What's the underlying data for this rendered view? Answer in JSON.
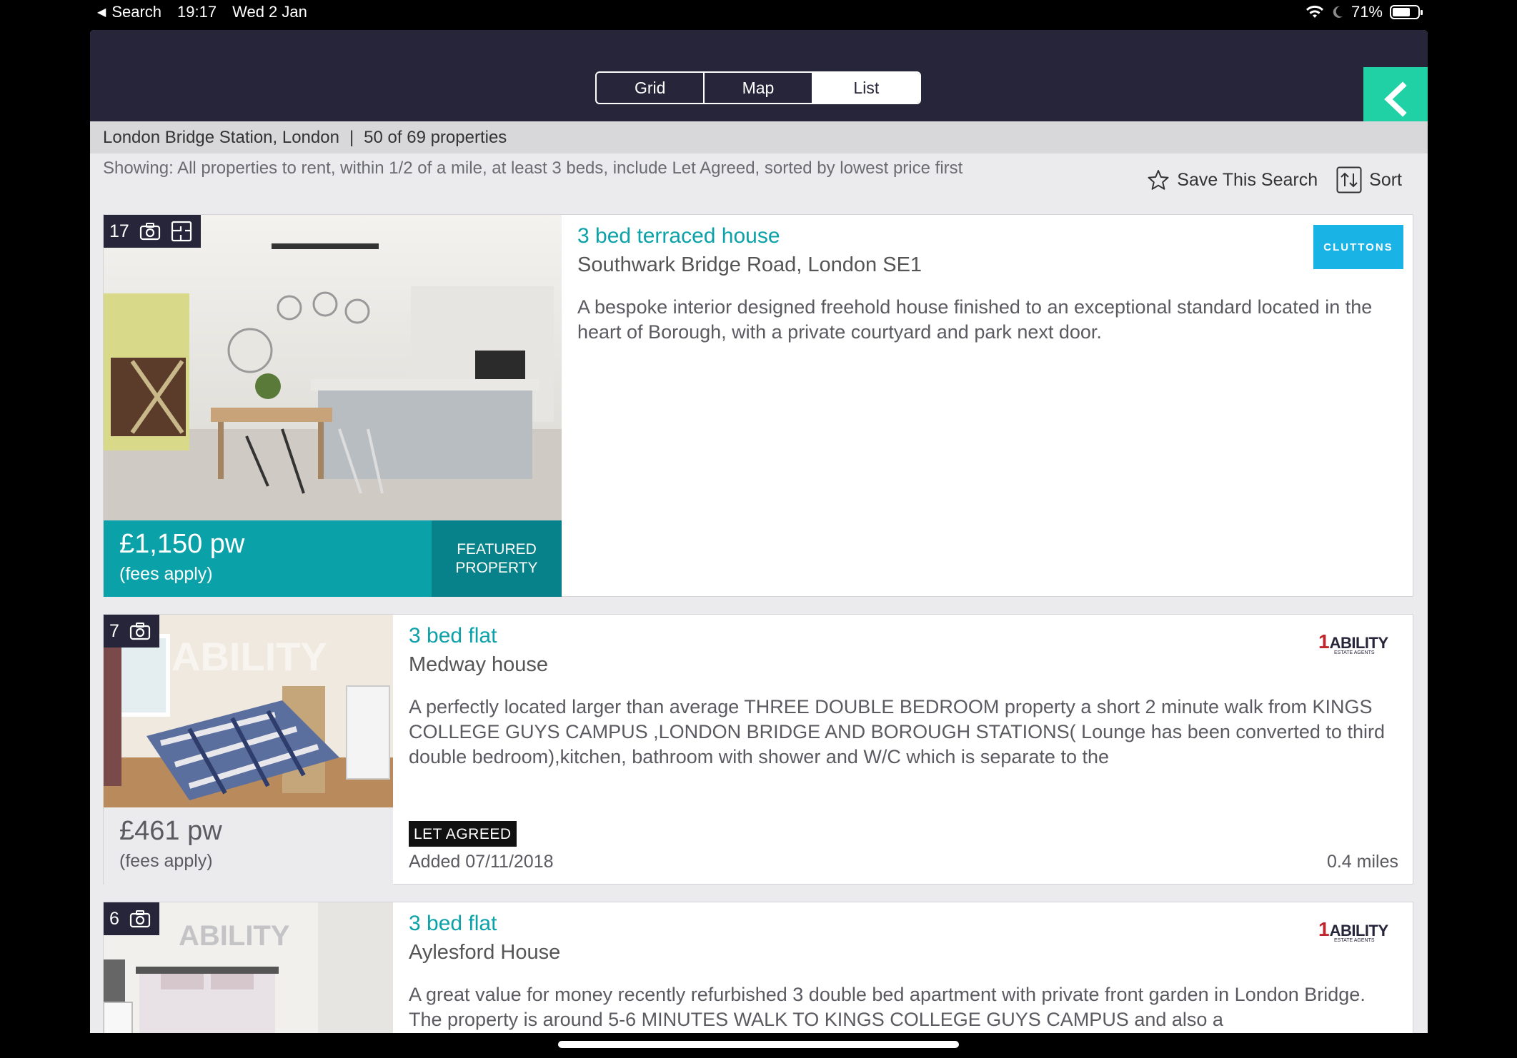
{
  "status": {
    "back_label": "Search",
    "time": "19:17",
    "date": "Wed 2 Jan",
    "battery": "71%",
    "battery_level": 0.71
  },
  "view_tabs": [
    {
      "label": "Grid",
      "active": false
    },
    {
      "label": "Map",
      "active": false
    },
    {
      "label": "List",
      "active": true
    }
  ],
  "colors": {
    "header": "#26253a",
    "accent_teal": "#0aa2a8",
    "back_button": "#1fd1a5",
    "cluttons": "#1ab3e6"
  },
  "location": {
    "place": "London Bridge Station, London",
    "separator": "|",
    "count": "50 of 69 properties"
  },
  "filter": {
    "text": "Showing: All properties to rent, within 1/2 of a mile, at least 3 beds, include Let Agreed, sorted by lowest price first",
    "save_label": "Save This Search",
    "sort_label": "Sort",
    "save_icon": "star-icon",
    "sort_icon": "sort-icon"
  },
  "listings": [
    {
      "photo_count": "17",
      "title": "3 bed terraced house",
      "address": "Southwark Bridge Road, London SE1",
      "description": "A bespoke interior designed freehold house finished to an exceptional standard located in the heart of Borough, with a private courtyard and park next door.",
      "price": "£1,150 pw",
      "fees": "(fees apply)",
      "featured_label": "FEATURED PROPERTY",
      "agent": "CLUTTONS"
    },
    {
      "photo_count": "7",
      "title": "3 bed flat",
      "address": "Medway house",
      "description": "A perfectly located larger than average THREE DOUBLE BEDROOM property a short 2 minute walk from KINGS COLLEGE GUYS CAMPUS ,LONDON BRIDGE AND BOROUGH STATIONS( Lounge has been converted to third double bedroom),kitchen, bathroom with shower and W/C which is separate to the",
      "price": "£461 pw",
      "fees": "(fees apply)",
      "badge": "LET AGREED",
      "added": "Added 07/11/2018",
      "distance": "0.4 miles",
      "agent": "ABILITY",
      "agent_sub": "ESTATE AGENTS",
      "agent_number": "1"
    },
    {
      "photo_count": "6",
      "title": "3 bed flat",
      "address": "Aylesford House",
      "description": "A great value for money recently refurbished 3 double bed apartment with private front garden in London Bridge. The property is around 5-6 MINUTES WALK TO KINGS COLLEGE GUYS CAMPUS and also a",
      "agent": "ABILITY",
      "agent_sub": "ESTATE AGENTS",
      "agent_number": "1"
    }
  ]
}
